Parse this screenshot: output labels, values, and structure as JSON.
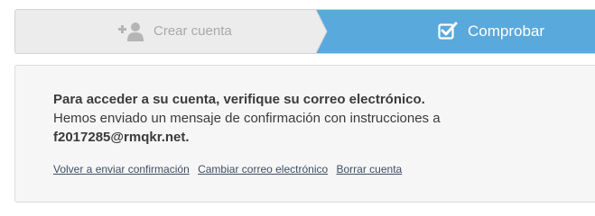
{
  "stepper": {
    "steps": [
      {
        "label": "Crear cuenta",
        "icon": "add-user-icon",
        "active": false
      },
      {
        "label": "Comprobar",
        "icon": "checkbox-checked-icon",
        "active": true
      }
    ],
    "colors": {
      "inactive_bg": "#ececec",
      "active_bg": "#5aa9dc",
      "inactive_text": "#a9a9a9"
    }
  },
  "verification": {
    "heading": "Para acceder a su cuenta, verifique su correo electrónico.",
    "body": "Hemos enviado un mensaje de confirmación con instrucciones a",
    "email": "f2017285@rmqkr.net."
  },
  "links": {
    "resend": "Volver a enviar confirmación",
    "change_email": "Cambiar correo electrónico",
    "delete_account": "Borrar cuenta"
  }
}
